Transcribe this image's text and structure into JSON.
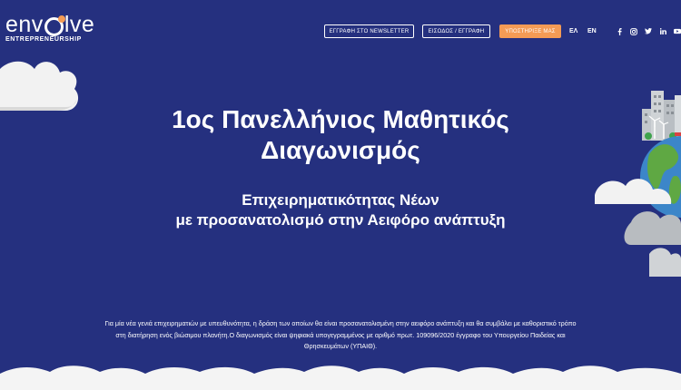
{
  "header": {
    "logo_text_pre": "env",
    "logo_text_post": "lve",
    "logo_subtitle": "ENTREPRENEURSHIP",
    "newsletter_button": "ΕΓΓΡΑΦΗ ΣΤΟ NEWSLETTER",
    "login_button": "ΕΙΣΟΔΟΣ / ΕΓΓΡΑΦΗ",
    "support_button": "ΥΠΟΣΤΗΡΙΞΕ ΜΑΣ",
    "lang_el": "ΕΛ",
    "lang_en": "EN",
    "social": [
      "facebook-icon",
      "instagram-icon",
      "twitter-icon",
      "linkedin-icon",
      "youtube-icon"
    ],
    "support_color": "#f49b55"
  },
  "hero": {
    "title_line1": "1ος Πανελλήνιος Μαθητικός",
    "title_line2": "Διαγωνισμός",
    "subtitle_line1": "Επιχειρηματικότητας Νέων",
    "subtitle_line2": "με προσανατολισμό στην Αειφόρο ανάπτυξη",
    "description": "Για μία νέα γενιά επιχειρηματιών με υπευθυνότητα, η δράση των οποίων θα είναι προσανατολισμένη στην αειφόρο ανάπτυξη και θα συμβάλει με καθοριστικό τρόπο στη διατήρηση ενός βιώσιμου πλανήτη.Ο διαγωνισμός είναι ψηφιακά υπογεγραμμένος με αριθμό πρωτ. 109096/2020 έγγραφο του Υπουργείου Παιδείας και Θρησκευμάτων (ΥΠΑΙΘ)."
  },
  "colors": {
    "background": "#25307f",
    "accent": "#f49b55",
    "text": "#ffffff"
  }
}
